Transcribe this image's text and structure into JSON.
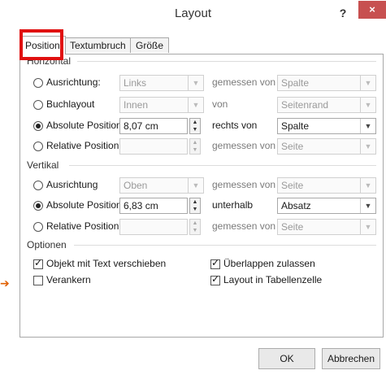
{
  "window": {
    "title": "Layout",
    "help": "?",
    "close": "×"
  },
  "tabs": [
    {
      "label": "Position",
      "active": true
    },
    {
      "label": "Textumbruch",
      "active": false
    },
    {
      "label": "Größe",
      "active": false
    }
  ],
  "horizontal": {
    "label": "Horizontal",
    "rows": [
      {
        "option": "Ausrichtung:",
        "selected": false,
        "value": "Links",
        "relation": "gemessen von",
        "target": "Spalte"
      },
      {
        "option": "Buchlayout",
        "selected": false,
        "value": "Innen",
        "relation": "von",
        "target": "Seitenrand"
      },
      {
        "option": "Absolute Position",
        "selected": true,
        "value": "8,07 cm",
        "relation": "rechts von",
        "target": "Spalte"
      },
      {
        "option": "Relative Position",
        "selected": false,
        "value": "",
        "relation": "gemessen von",
        "target": "Seite"
      }
    ]
  },
  "vertical": {
    "label": "Vertikal",
    "rows": [
      {
        "option": "Ausrichtung",
        "selected": false,
        "value": "Oben",
        "relation": "gemessen von",
        "target": "Seite"
      },
      {
        "option": "Absolute Position",
        "selected": true,
        "value": "6,83 cm",
        "relation": "unterhalb",
        "target": "Absatz"
      },
      {
        "option": "Relative Position",
        "selected": false,
        "value": "",
        "relation": "gemessen von",
        "target": "Seite"
      }
    ]
  },
  "options": {
    "label": "Optionen",
    "items": [
      {
        "label": "Objekt mit Text verschieben",
        "checked": true
      },
      {
        "label": "Verankern",
        "checked": false
      },
      {
        "label": "Überlappen zulassen",
        "checked": true
      },
      {
        "label": "Layout in Tabellenzelle",
        "checked": true
      }
    ]
  },
  "buttons": {
    "ok": "OK",
    "cancel": "Abbrechen"
  },
  "icons": {
    "radio": "radio-button",
    "checkbox": "checkbox",
    "dropdown": "chevron-down-icon",
    "spin": "spin-arrows-icon"
  },
  "colors": {
    "highlight": "#e01010",
    "close": "#c75050",
    "pointer": "#e06000"
  }
}
